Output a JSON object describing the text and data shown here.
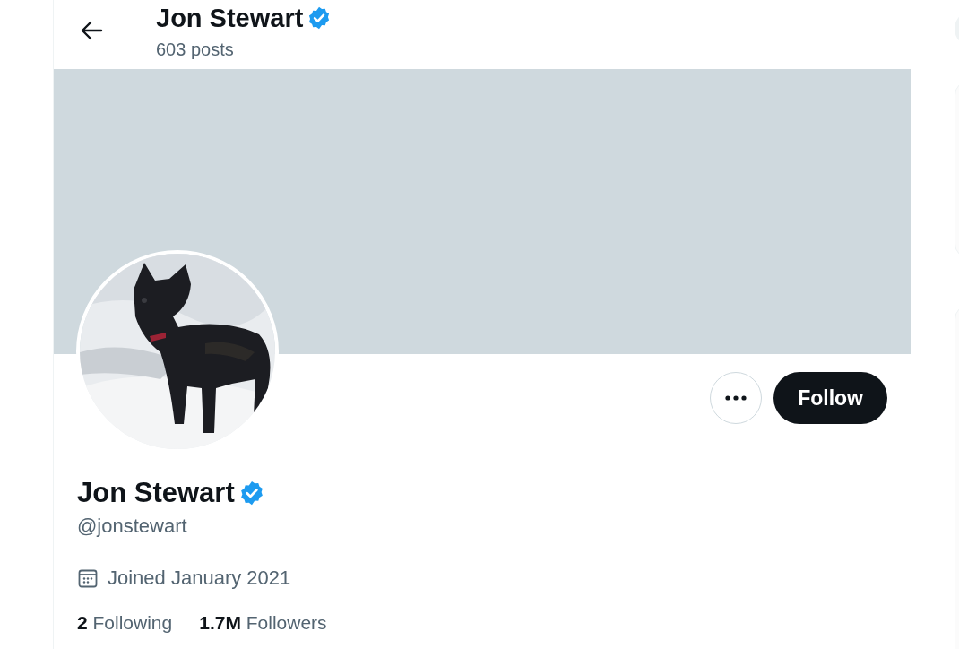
{
  "header": {
    "name": "Jon Stewart",
    "verified": true,
    "posts": "603 posts"
  },
  "actions": {
    "follow": "Follow"
  },
  "profile": {
    "name": "Jon Stewart",
    "verified": true,
    "handle": "@jonstewart",
    "joined": "Joined January 2021"
  },
  "stats": [
    {
      "count": "2",
      "label": "Following"
    },
    {
      "count": "1.7M",
      "label": "Followers"
    }
  ]
}
